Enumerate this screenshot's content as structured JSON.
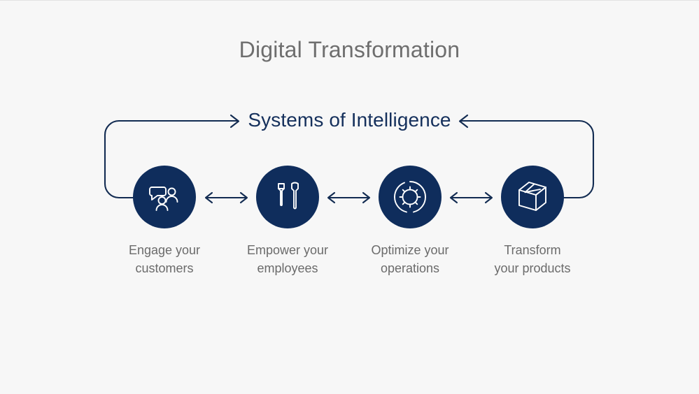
{
  "slide": {
    "title": "Digital Transformation",
    "background_color": "#f7f7f7",
    "accent_color": "#0f2d5c",
    "label_color": "#6b6b6b"
  },
  "cycle": {
    "heading": "Systems of Intelligence",
    "left_loop_arrow": "arrow-right",
    "right_loop_arrow": "arrow-left"
  },
  "pillars": [
    {
      "icon": "customers-speech-bubble-icon",
      "label": "Engage your\ncustomers",
      "label_line1": "Engage your",
      "label_line2": "customers"
    },
    {
      "icon": "tools-screwdriver-wrench-icon",
      "label": "Empower your\nemployees",
      "label_line1": "Empower your",
      "label_line2": "employees"
    },
    {
      "icon": "gear-operations-icon",
      "label": "Optimize your\noperations",
      "label_line1": "Optimize your",
      "label_line2": "operations"
    },
    {
      "icon": "package-box-icon",
      "label": "Transform\nyour products",
      "label_line1": "Transform",
      "label_line2": "your products"
    }
  ],
  "connectors": [
    {
      "name": "double-arrow-1",
      "type": "bidirectional"
    },
    {
      "name": "double-arrow-2",
      "type": "bidirectional"
    },
    {
      "name": "double-arrow-3",
      "type": "bidirectional"
    }
  ]
}
